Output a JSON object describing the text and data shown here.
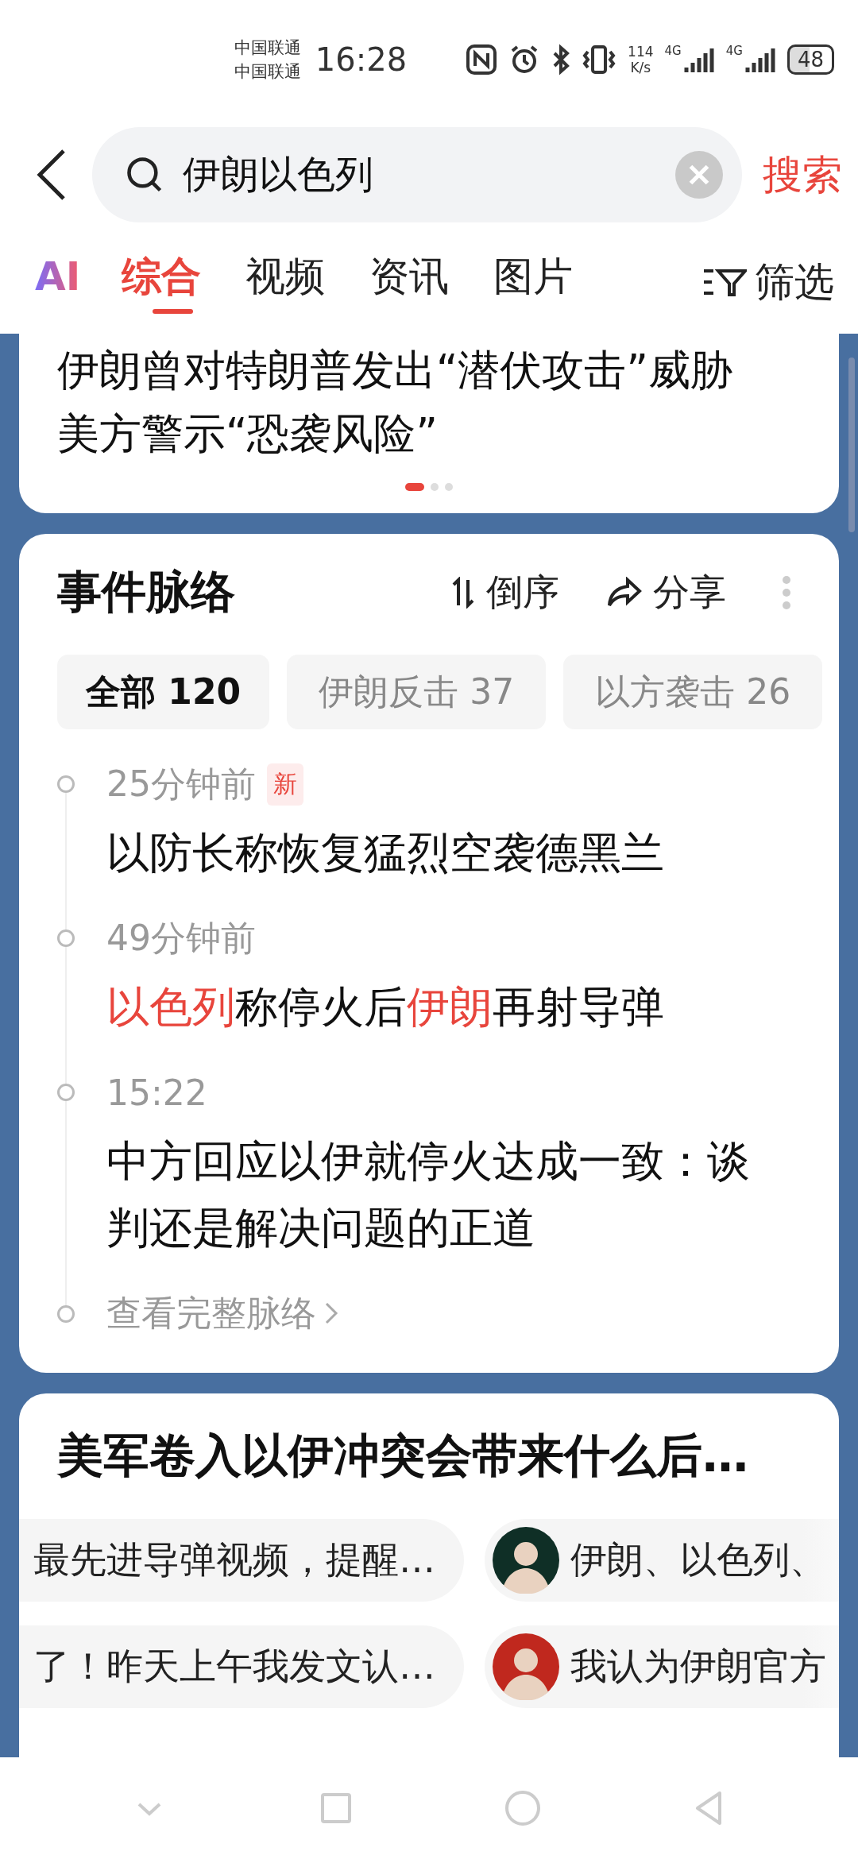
{
  "status_bar": {
    "carriers": [
      "中国联通",
      "中国联通"
    ],
    "time": "16:28",
    "net_speed": [
      "114",
      "K/s"
    ],
    "signal_labels": [
      "4G",
      "4G"
    ],
    "battery": "48"
  },
  "search": {
    "value": "伊朗以色列",
    "submit": "搜索"
  },
  "tabs": [
    {
      "label": "AI",
      "kind": "ai",
      "selected": false
    },
    {
      "label": "综合",
      "kind": "text",
      "selected": true
    },
    {
      "label": "视频",
      "kind": "text",
      "selected": false
    },
    {
      "label": "资讯",
      "kind": "text",
      "selected": false
    },
    {
      "label": "图片",
      "kind": "text",
      "selected": false
    }
  ],
  "filter": "筛选",
  "top_card": {
    "lines": [
      "伊朗曾对特朗普发出“潜伏攻击”威胁",
      "美方警示“恐袭风险”"
    ],
    "pager": [
      {
        "selected": true
      },
      {
        "selected": false
      },
      {
        "selected": false
      }
    ]
  },
  "timeline": {
    "title": "事件脉络",
    "sort": "倒序",
    "share": "分享",
    "filters": [
      {
        "label": "全部 120",
        "selected": true
      },
      {
        "label": "伊朗反击 37",
        "selected": false
      },
      {
        "label": "以方袭击 26",
        "selected": false
      }
    ],
    "events": [
      {
        "time": "25分钟前",
        "badge": "新",
        "headline": [
          {
            "text": "以防长称恢复猛烈空袭德黑兰",
            "highlight": false
          }
        ]
      },
      {
        "time": "49分钟前",
        "headline": [
          {
            "text": "以色列",
            "highlight": true
          },
          {
            "text": "称停火后",
            "highlight": false
          },
          {
            "text": "伊朗",
            "highlight": true
          },
          {
            "text": "再射导弹",
            "highlight": false
          }
        ]
      },
      {
        "time": "15:22",
        "headline": [
          {
            "text": "中方回应以伊就停火达成一致：谈判还是解决问题的正道",
            "highlight": false
          }
        ]
      }
    ],
    "more": "查看完整脉络"
  },
  "question_card": {
    "title": "美军卷入以伊冲突会带来什么后…",
    "rows": [
      [
        {
          "kind": "text",
          "text": "最先进导弹视频，提醒…"
        },
        {
          "kind": "avatar",
          "color": "#0f2f26",
          "text": "伊朗、以色列、"
        }
      ],
      [
        {
          "kind": "text",
          "text": "了！昨天上午我发文认…"
        },
        {
          "kind": "avatar",
          "color": "#c0281e",
          "text": "我认为伊朗官方"
        }
      ]
    ]
  }
}
